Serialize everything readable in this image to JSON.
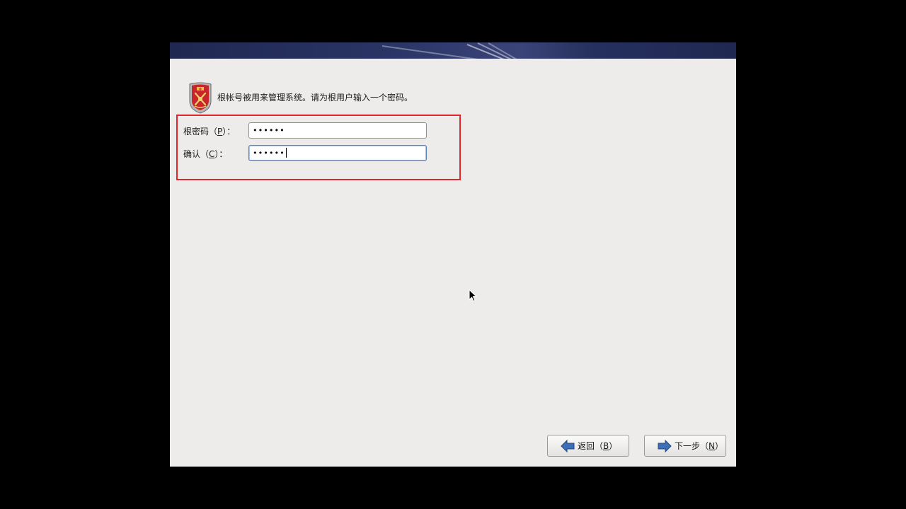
{
  "header": {
    "description": "根帐号被用来管理系统。请为根用户输入一个密码。",
    "icon": "root-shield-icon"
  },
  "form": {
    "password": {
      "label_pre": "根密码（",
      "mnemonic": "P",
      "label_post": "）：",
      "value": "••••••"
    },
    "confirm": {
      "label_pre": "确认（",
      "mnemonic": "C",
      "label_post": "）：",
      "value": "••••••"
    }
  },
  "buttons": {
    "back": {
      "label_pre": "返回（",
      "mnemonic": "B",
      "label_post": "）",
      "icon": "arrow-left-icon"
    },
    "next": {
      "label_pre": "下一步（",
      "mnemonic": "N",
      "label_post": "）",
      "icon": "arrow-right-icon"
    }
  },
  "colors": {
    "banner": "#1f2850",
    "highlight": "#e0262e",
    "window_bg": "#edecea",
    "arrow_blue": "#3c6fb6"
  }
}
